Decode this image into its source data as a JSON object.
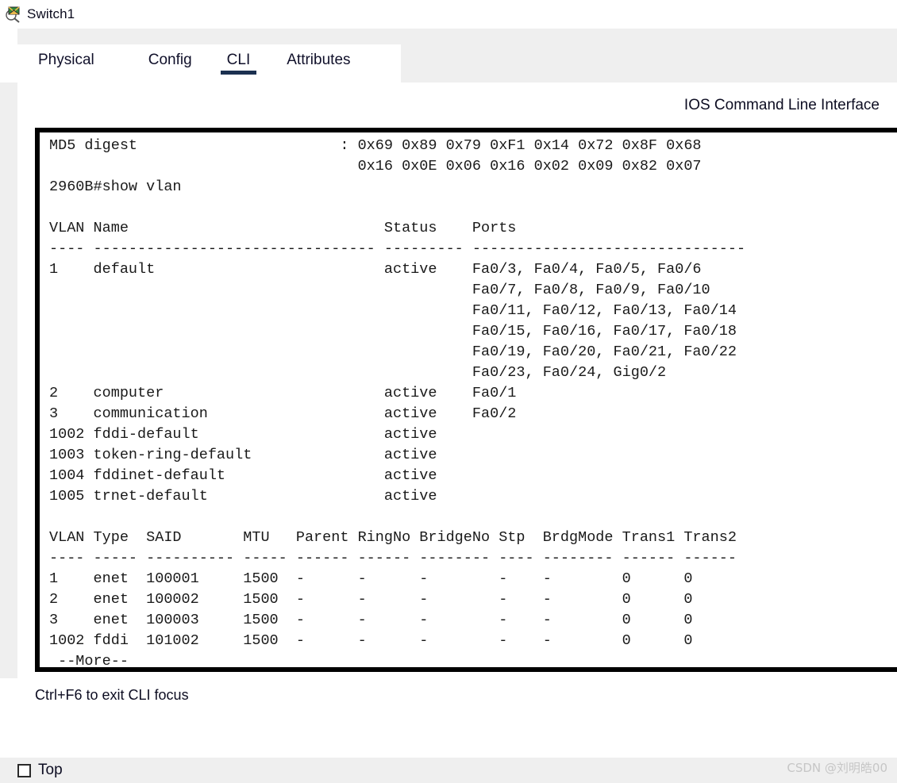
{
  "window": {
    "title": "Switch1",
    "icon": "switch-magnifier-icon"
  },
  "tabs": [
    {
      "id": "physical",
      "label": "Physical",
      "active": false
    },
    {
      "id": "config",
      "label": "Config",
      "active": false
    },
    {
      "id": "cli",
      "label": "CLI",
      "active": true
    },
    {
      "id": "attributes",
      "label": "Attributes",
      "active": false
    }
  ],
  "cli": {
    "header": "IOS Command Line Interface",
    "status_hint": "Ctrl+F6 to exit CLI focus",
    "accent_color": "#1b3050",
    "prompt": "2960B#",
    "command": "show vlan",
    "more_marker": "--More--",
    "lines": [
      "MD5 digest                       : 0x69 0x89 0x79 0xF1 0x14 0x72 0x8F 0x68",
      "                                   0x16 0x0E 0x06 0x16 0x02 0x09 0x82 0x07",
      "2960B#show vlan",
      "",
      "VLAN Name                             Status    Ports",
      "---- -------------------------------- --------- -------------------------------",
      "1    default                          active    Fa0/3, Fa0/4, Fa0/5, Fa0/6",
      "                                                Fa0/7, Fa0/8, Fa0/9, Fa0/10",
      "                                                Fa0/11, Fa0/12, Fa0/13, Fa0/14",
      "                                                Fa0/15, Fa0/16, Fa0/17, Fa0/18",
      "                                                Fa0/19, Fa0/20, Fa0/21, Fa0/22",
      "                                                Fa0/23, Fa0/24, Gig0/2",
      "2    computer                         active    Fa0/1",
      "3    communication                    active    Fa0/2",
      "1002 fddi-default                     active",
      "1003 token-ring-default               active",
      "1004 fddinet-default                  active",
      "1005 trnet-default                    active",
      "",
      "VLAN Type  SAID       MTU   Parent RingNo BridgeNo Stp  BrdgMode Trans1 Trans2",
      "---- ----- ---------- ----- ------ ------ -------- ---- -------- ------ ------",
      "1    enet  100001     1500  -      -      -        -    -        0      0",
      "2    enet  100002     1500  -      -      -        -    -        0      0",
      "3    enet  100003     1500  -      -      -        -    -        0      0",
      "1002 fddi  101002     1500  -      -      -        -    -        0      0",
      " --More--"
    ],
    "md5_digest": {
      "label": "MD5 digest",
      "row1": [
        "0x69",
        "0x89",
        "0x79",
        "0xF1",
        "0x14",
        "0x72",
        "0x8F",
        "0x68"
      ],
      "row2": [
        "0x16",
        "0x0E",
        "0x06",
        "0x16",
        "0x02",
        "0x09",
        "0x82",
        "0x07"
      ]
    },
    "vlan_table": {
      "headers": [
        "VLAN",
        "Name",
        "Status",
        "Ports"
      ],
      "rows": [
        {
          "vlan": "1",
          "name": "default",
          "status": "active",
          "ports": [
            "Fa0/3, Fa0/4, Fa0/5, Fa0/6",
            "Fa0/7, Fa0/8, Fa0/9, Fa0/10",
            "Fa0/11, Fa0/12, Fa0/13, Fa0/14",
            "Fa0/15, Fa0/16, Fa0/17, Fa0/18",
            "Fa0/19, Fa0/20, Fa0/21, Fa0/22",
            "Fa0/23, Fa0/24, Gig0/2"
          ]
        },
        {
          "vlan": "2",
          "name": "computer",
          "status": "active",
          "ports": [
            "Fa0/1"
          ]
        },
        {
          "vlan": "3",
          "name": "communication",
          "status": "active",
          "ports": [
            "Fa0/2"
          ]
        },
        {
          "vlan": "1002",
          "name": "fddi-default",
          "status": "active",
          "ports": []
        },
        {
          "vlan": "1003",
          "name": "token-ring-default",
          "status": "active",
          "ports": []
        },
        {
          "vlan": "1004",
          "name": "fddinet-default",
          "status": "active",
          "ports": []
        },
        {
          "vlan": "1005",
          "name": "trnet-default",
          "status": "active",
          "ports": []
        }
      ]
    },
    "vlan_detail_table": {
      "headers": [
        "VLAN",
        "Type",
        "SAID",
        "MTU",
        "Parent",
        "RingNo",
        "BridgeNo",
        "Stp",
        "BrdgMode",
        "Trans1",
        "Trans2"
      ],
      "rows": [
        [
          "1",
          "enet",
          "100001",
          "1500",
          "-",
          "-",
          "-",
          "-",
          "-",
          "0",
          "0"
        ],
        [
          "2",
          "enet",
          "100002",
          "1500",
          "-",
          "-",
          "-",
          "-",
          "-",
          "0",
          "0"
        ],
        [
          "3",
          "enet",
          "100003",
          "1500",
          "-",
          "-",
          "-",
          "-",
          "-",
          "0",
          "0"
        ],
        [
          "1002",
          "fddi",
          "101002",
          "1500",
          "-",
          "-",
          "-",
          "-",
          "-",
          "0",
          "0"
        ]
      ]
    }
  },
  "footer": {
    "checkbox_label": "Top",
    "checked": false
  },
  "watermark": "CSDN @刘明皓00"
}
